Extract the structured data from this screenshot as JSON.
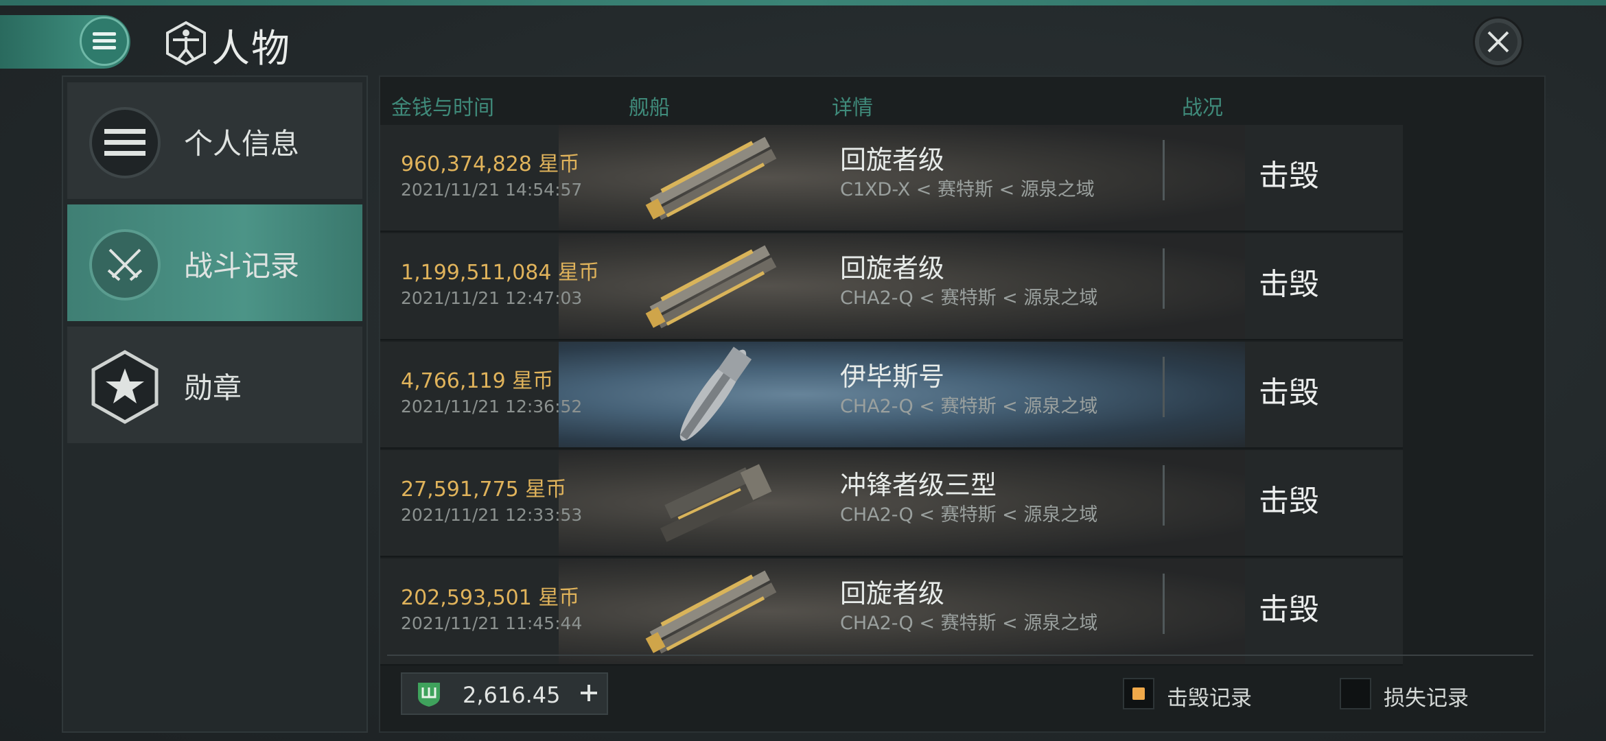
{
  "header": {
    "title": "人物"
  },
  "sidebar": {
    "items": [
      {
        "label": "个人信息",
        "icon": "list-icon",
        "active": false
      },
      {
        "label": "战斗记录",
        "icon": "crossed-swords-icon",
        "active": true
      },
      {
        "label": "勋章",
        "icon": "star-badge-icon",
        "active": false
      }
    ]
  },
  "table": {
    "headers": {
      "money_time": "金钱与时间",
      "ship": "舰船",
      "details": "详情",
      "status": "战况"
    },
    "rows": [
      {
        "money": "960,374,828  星币",
        "time": "2021/11/21  14:54:57",
        "ship": "回旋者级",
        "location": "C1XD-X < 赛特斯 < 源泉之域",
        "result": "击毁"
      },
      {
        "money": "1,199,511,084  星币",
        "time": "2021/11/21  12:47:03",
        "ship": "回旋者级",
        "location": "CHA2-Q < 赛特斯 < 源泉之域",
        "result": "击毁"
      },
      {
        "money": "4,766,119  星币",
        "time": "2021/11/21  12:36:52",
        "ship": "伊毕斯号",
        "location": "CHA2-Q < 赛特斯 < 源泉之域",
        "result": "击毁"
      },
      {
        "money": "27,591,775  星币",
        "time": "2021/11/21  12:33:53",
        "ship": "冲锋者级三型",
        "location": "CHA2-Q < 赛特斯 < 源泉之域",
        "result": "击毁"
      },
      {
        "money": "202,593,501  星币",
        "time": "2021/11/21  11:45:44",
        "ship": "回旋者级",
        "location": "CHA2-Q < 赛特斯 < 源泉之域",
        "result": "击毁"
      }
    ]
  },
  "footer": {
    "currency_value": "2,616.45",
    "filter_kills": "击毁记录",
    "filter_losses": "损失记录",
    "kills_checked": true,
    "losses_checked": false
  },
  "colors": {
    "accent": "#3f8a7a",
    "money": "#e0b35b",
    "checkbox": "#f0a94a"
  }
}
